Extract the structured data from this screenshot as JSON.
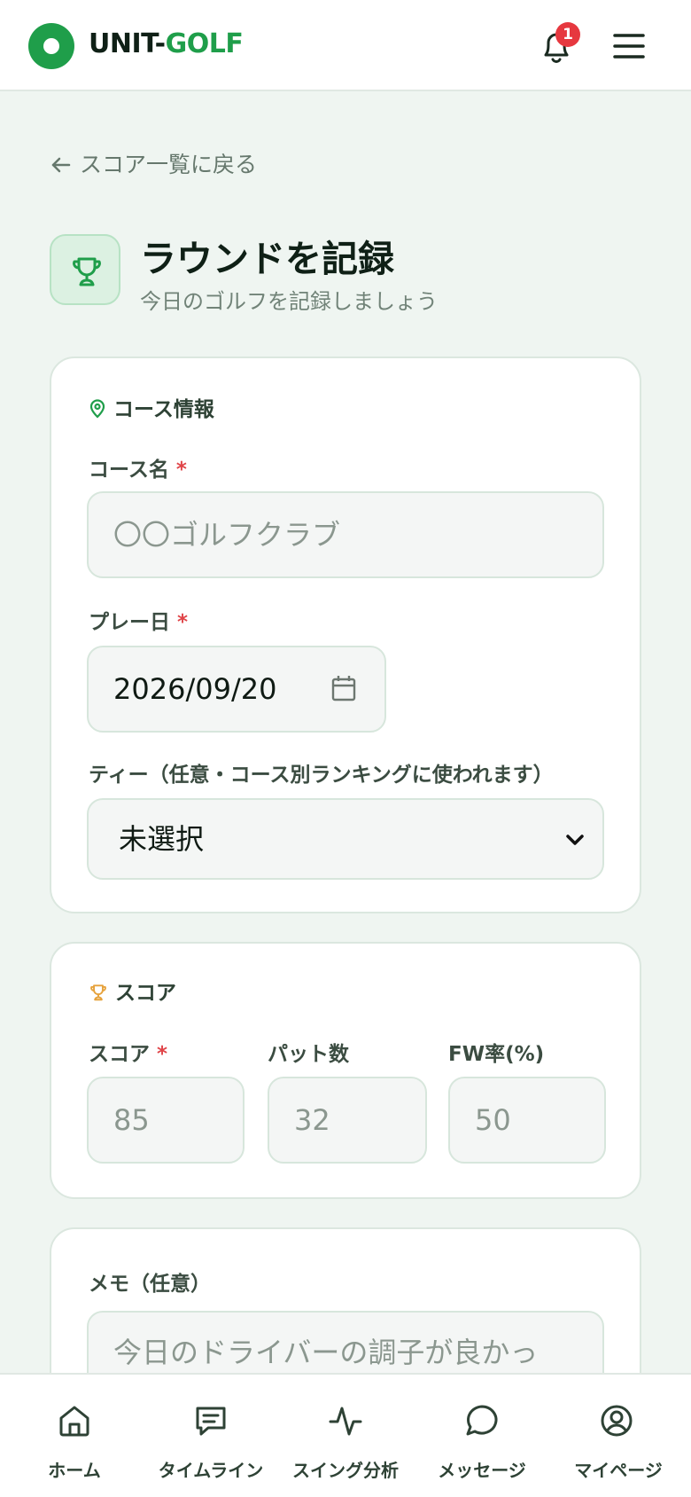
{
  "header": {
    "brand_part1": "UNIT-",
    "brand_part2": "GOLF",
    "notification_count": "1",
    "colors": {
      "brand": "#1f9e4a",
      "badge": "#e6383f"
    }
  },
  "nav": {
    "back_label": "スコア一覧に戻る"
  },
  "page": {
    "title": "ラウンドを記録",
    "subtitle": "今日のゴルフを記録しましょう"
  },
  "course_section": {
    "title": "コース情報",
    "course_name_label": "コース名",
    "course_name_placeholder": "〇〇ゴルフクラブ",
    "date_label": "プレー日",
    "date_value": "2026/09/20",
    "tee_label": "ティー（任意・コース別ランキングに使われます）",
    "tee_value": "未選択"
  },
  "score_section": {
    "title": "スコア",
    "score_label": "スコア",
    "score_placeholder": "85",
    "putts_label": "パット数",
    "putts_placeholder": "32",
    "fw_label": "FW率(%)",
    "fw_placeholder": "50"
  },
  "memo_section": {
    "label": "メモ（任意）",
    "placeholder": "今日のドライバーの調子が良かっ"
  },
  "required_mark": "*",
  "bottom_nav": {
    "items": [
      {
        "label": "ホーム",
        "icon": "home-icon"
      },
      {
        "label": "タイムライン",
        "icon": "timeline-icon"
      },
      {
        "label": "スイング分析",
        "icon": "activity-icon"
      },
      {
        "label": "メッセージ",
        "icon": "message-icon"
      },
      {
        "label": "マイページ",
        "icon": "user-circle-icon"
      }
    ]
  }
}
